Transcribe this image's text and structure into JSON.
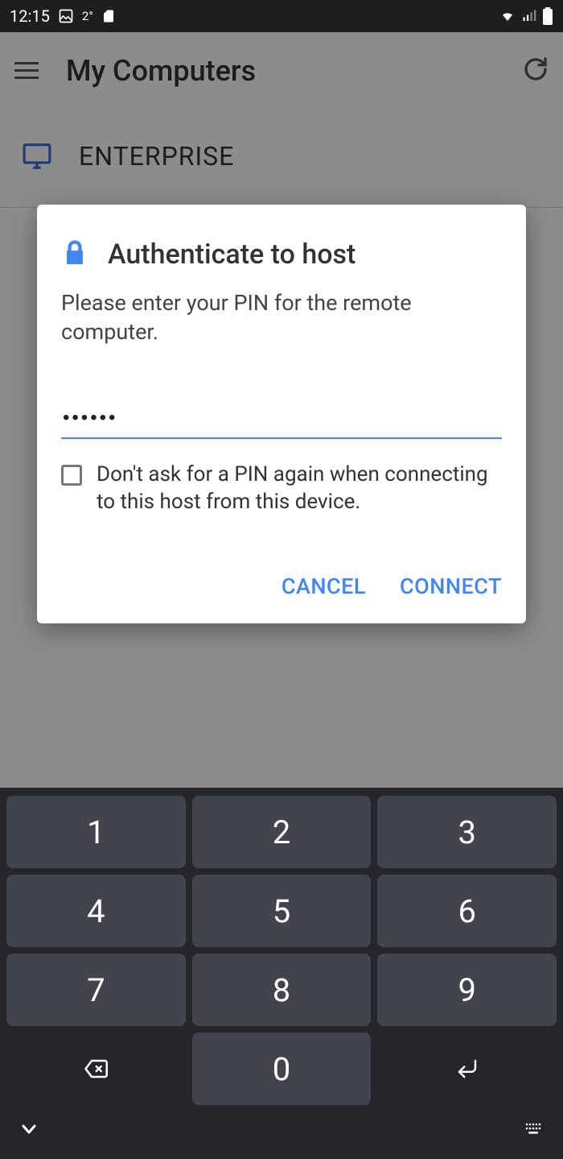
{
  "status": {
    "time": "12:15",
    "temp": "2°"
  },
  "appbar": {
    "title": "My Computers"
  },
  "computers": [
    {
      "name": "ENTERPRISE"
    }
  ],
  "dialog": {
    "title": "Authenticate to host",
    "message": "Please enter your PIN for the remote computer.",
    "pin_value": "••••••",
    "checkbox_label": "Don't ask for a PIN again when connecting to this host from this device.",
    "cancel": "CANCEL",
    "connect": "CONNECT"
  },
  "keypad": {
    "k1": "1",
    "k2": "2",
    "k3": "3",
    "k4": "4",
    "k5": "5",
    "k6": "6",
    "k7": "7",
    "k8": "8",
    "k9": "9",
    "k0": "0"
  }
}
